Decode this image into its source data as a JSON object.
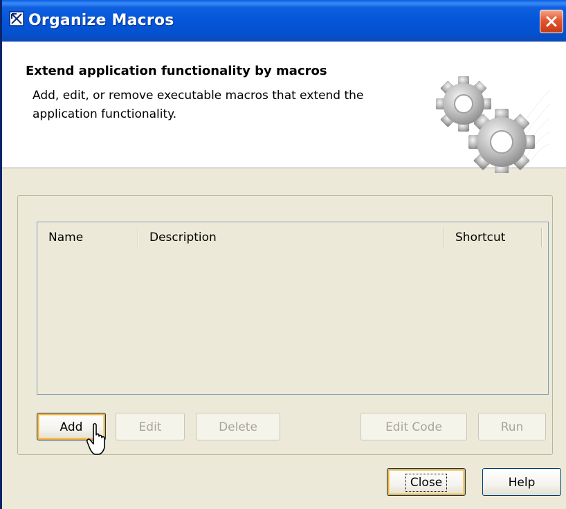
{
  "window": {
    "title": "Organize Macros",
    "icon": "macro-window-icon",
    "close_icon": "close-icon"
  },
  "header": {
    "title": "Extend application functionality by macros",
    "description": "Add, edit, or remove executable macros that extend the application functionality.",
    "illustration": "gears-icon"
  },
  "table": {
    "columns": [
      "Name",
      "Description",
      "Shortcut"
    ],
    "rows": []
  },
  "actions": {
    "add": "Add",
    "edit": "Edit",
    "delete": "Delete",
    "edit_code": "Edit Code",
    "run": "Run"
  },
  "footer": {
    "close": "Close",
    "help": "Help"
  },
  "colors": {
    "titlebar": "#0555d9",
    "dialog_bg": "#ece9d8",
    "close_button": "#e4562f",
    "table_border": "#7f9db9"
  }
}
